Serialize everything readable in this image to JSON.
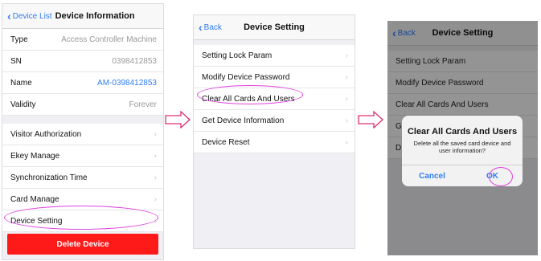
{
  "screen1": {
    "back_label": "Device List",
    "title": "Device Information",
    "info_rows": [
      {
        "label": "Type",
        "value": "Access Controller Machine"
      },
      {
        "label": "SN",
        "value": "0398412853"
      },
      {
        "label": "Name",
        "value": "AM-0398412853"
      },
      {
        "label": "Validity",
        "value": "Forever"
      }
    ],
    "menu_items": [
      "Visitor Authorization",
      "Ekey Manage",
      "Synchronization Time",
      "Card Manage",
      "Device Setting"
    ],
    "delete_label": "Delete Device"
  },
  "screen2": {
    "back_label": "Back",
    "title": "Device Setting",
    "items": [
      "Setting Lock Param",
      "Modify Device Password",
      "Clear All Cards And Users",
      "Get Device Information",
      "Device Reset"
    ]
  },
  "screen3": {
    "back_label": "Back",
    "title": "Device Setting",
    "items": [
      "Setting Lock Param",
      "Modify Device Password",
      "Clear All Cards And Users",
      "G",
      "D"
    ],
    "alert": {
      "title": "Clear All Cards And Users",
      "message": "Delete all the saved card device and user information?",
      "cancel_label": "Cancel",
      "ok_label": "OK"
    }
  },
  "colors": {
    "accent": "#2f7cf6",
    "danger": "#ff1a1a",
    "highlight": "#e040e0",
    "arrow": "#e0306a"
  }
}
